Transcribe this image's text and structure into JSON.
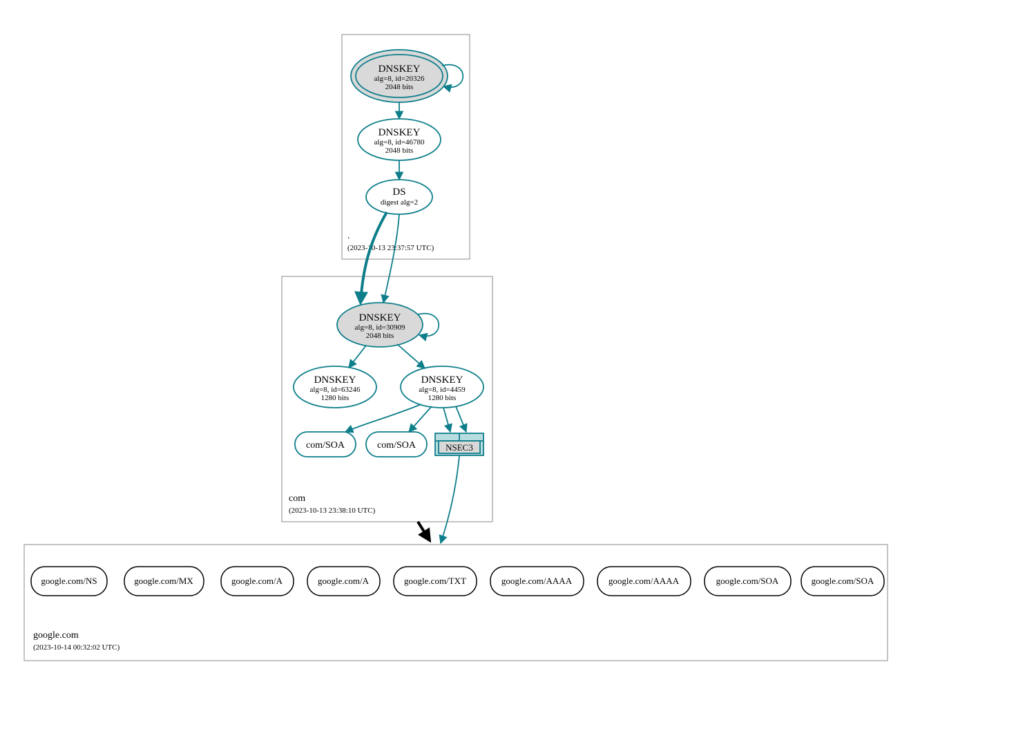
{
  "zones": {
    "root": {
      "label": ".",
      "time": "(2023-10-13 23:37:57 UTC)"
    },
    "com": {
      "label": "com",
      "time": "(2023-10-13 23:38:10 UTC)"
    },
    "google": {
      "label": "google.com",
      "time": "(2023-10-14 00:32:02 UTC)"
    }
  },
  "nodes": {
    "root_ksk": {
      "title": "DNSKEY",
      "line1": "alg=8, id=20326",
      "line2": "2048 bits"
    },
    "root_zsk": {
      "title": "DNSKEY",
      "line1": "alg=8, id=46780",
      "line2": "2048 bits"
    },
    "root_ds": {
      "title": "DS",
      "line1": "digest alg=2"
    },
    "com_ksk": {
      "title": "DNSKEY",
      "line1": "alg=8, id=30909",
      "line2": "2048 bits"
    },
    "com_zsk1": {
      "title": "DNSKEY",
      "line1": "alg=8, id=63246",
      "line2": "1280 bits"
    },
    "com_zsk2": {
      "title": "DNSKEY",
      "line1": "alg=8, id=4459",
      "line2": "1280 bits"
    },
    "com_soa1": {
      "label": "com/SOA"
    },
    "com_soa2": {
      "label": "com/SOA"
    },
    "nsec3": {
      "label": "NSEC3"
    }
  },
  "rr": [
    {
      "label": "google.com/NS"
    },
    {
      "label": "google.com/MX"
    },
    {
      "label": "google.com/A"
    },
    {
      "label": "google.com/A"
    },
    {
      "label": "google.com/TXT"
    },
    {
      "label": "google.com/AAAA"
    },
    {
      "label": "google.com/AAAA"
    },
    {
      "label": "google.com/SOA"
    },
    {
      "label": "google.com/SOA"
    }
  ]
}
